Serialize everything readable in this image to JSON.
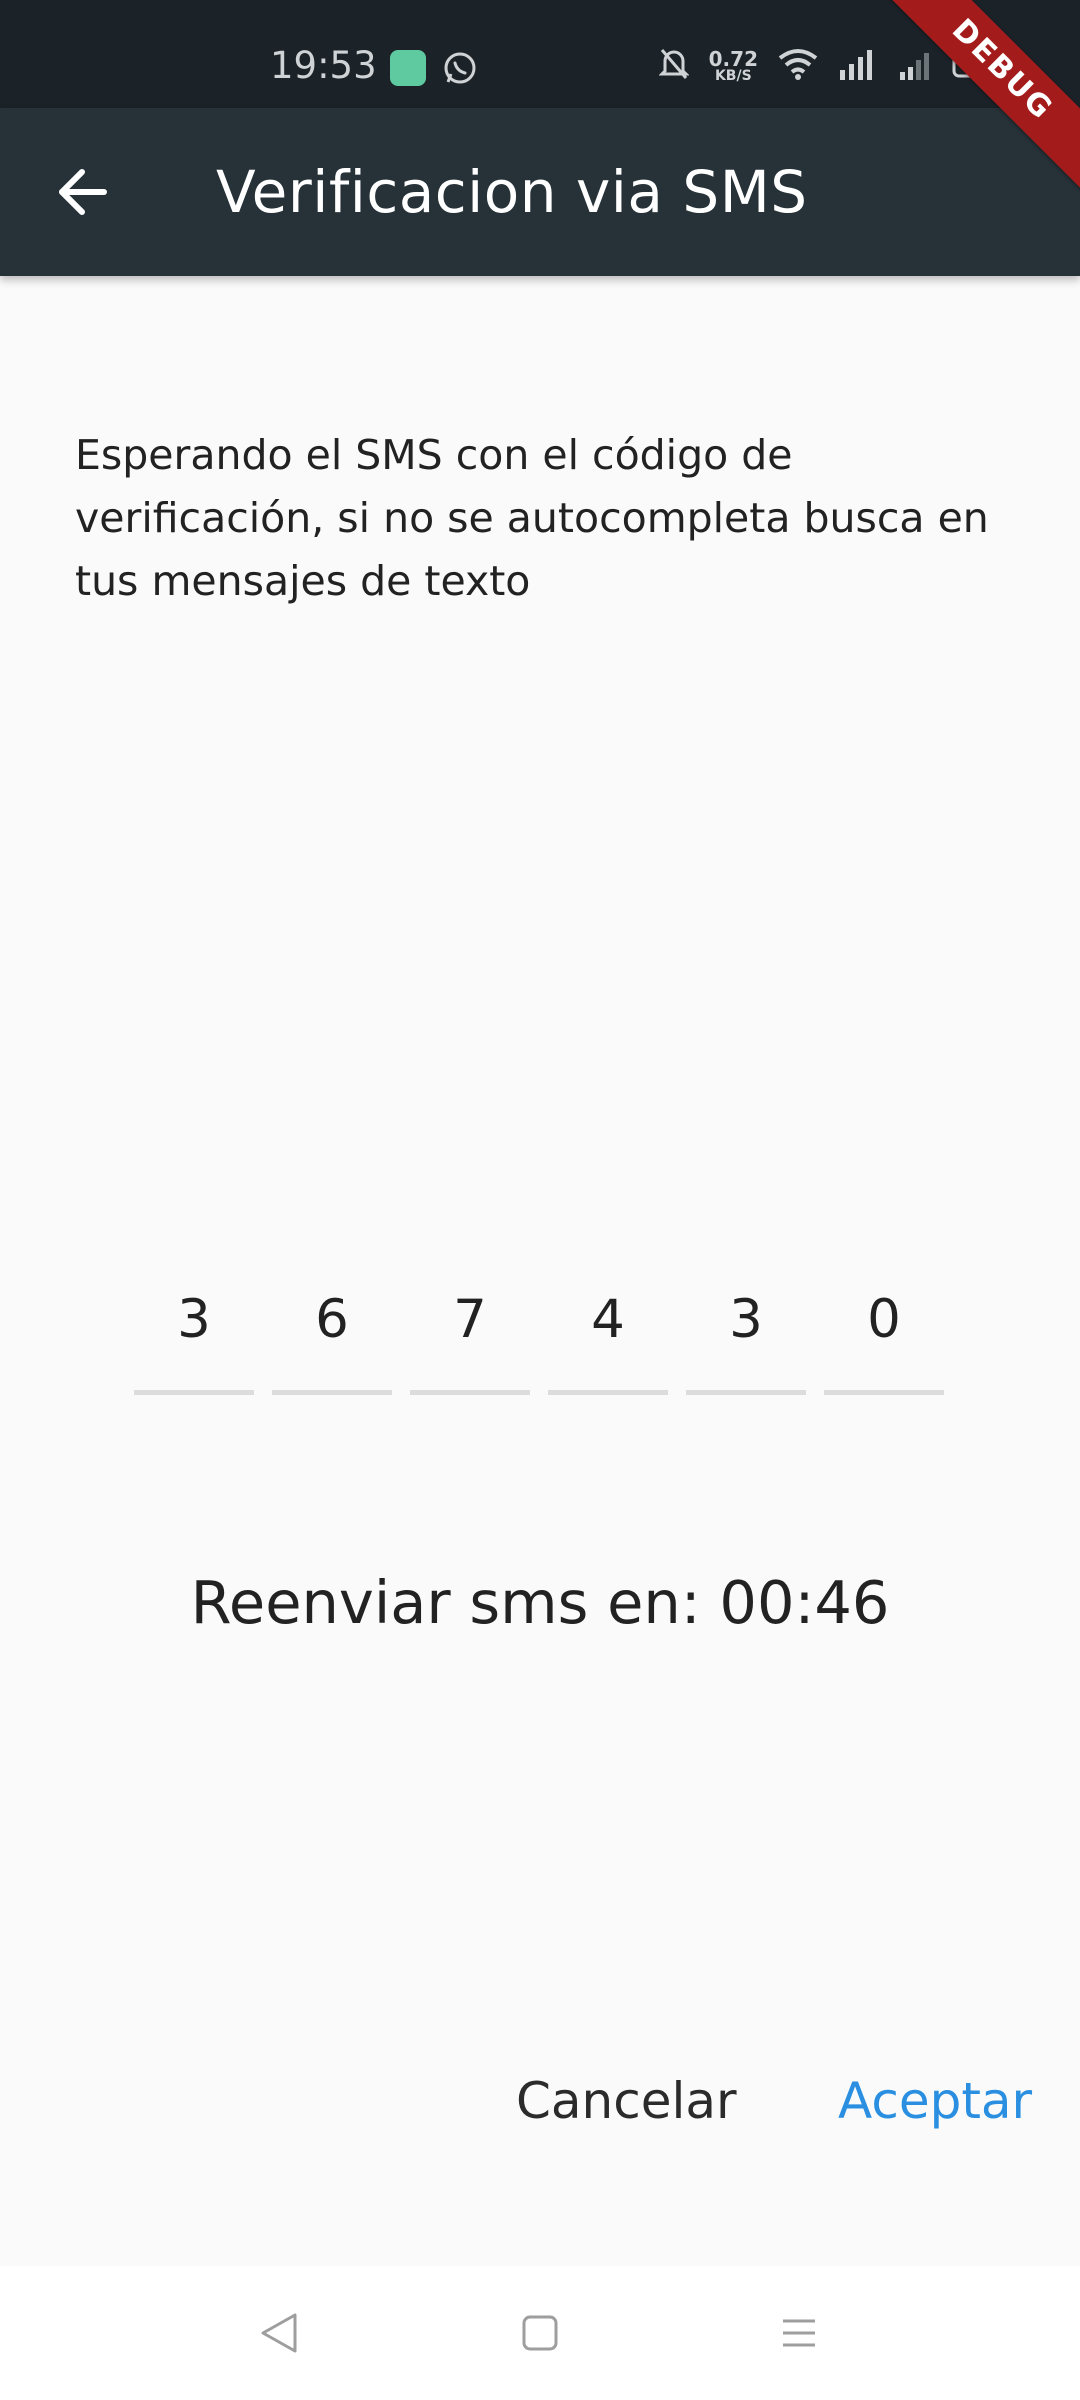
{
  "status_bar": {
    "time": "19:53",
    "net_speed_value": "0.72",
    "net_speed_unit": "KB/S",
    "battery_icon": "battery-icon",
    "wifi_icon": "wifi-icon",
    "signal_icon": "signal-icon",
    "mute_icon": "bell-off-icon"
  },
  "debug_banner": "DEBUG",
  "app_bar": {
    "title": "Verificacion via SMS",
    "back_icon": "arrow-back-icon",
    "background": "#263238"
  },
  "instructions": "Esperando el SMS con el código de verificación, si no se autocompleta busca en tus mensajes de texto",
  "otp": {
    "digits": [
      "3",
      "6",
      "7",
      "4",
      "3",
      "0"
    ]
  },
  "resend": {
    "text": "Reenviar sms en: 00:46"
  },
  "actions": {
    "cancel_label": "Cancelar",
    "accept_label": "Aceptar",
    "accent_color": "#2a8fe0"
  },
  "nav_bar": {
    "back": "nav-back-icon",
    "home": "nav-home-icon",
    "menu": "nav-menu-icon"
  }
}
